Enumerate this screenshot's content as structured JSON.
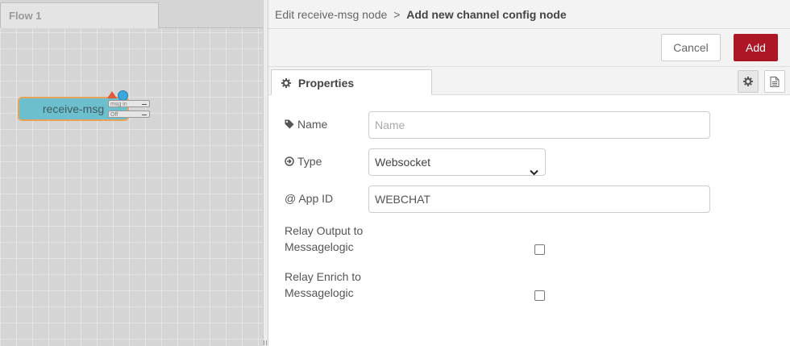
{
  "workspace": {
    "flow_tab": "Flow 1",
    "node": {
      "label": "receive-msg",
      "ports": [
        "msg in",
        "Off"
      ]
    }
  },
  "editor": {
    "breadcrumb_parent": "Edit receive-msg node",
    "breadcrumb_sep": ">",
    "breadcrumb_current": "Add new channel config node",
    "cancel_label": "Cancel",
    "add_label": "Add",
    "tab_properties": "Properties",
    "fields": {
      "name_label": "Name",
      "name_placeholder": "Name",
      "type_label": "Type",
      "type_value": "Websocket",
      "appid_label": "@ App ID",
      "appid_value": "WEBCHAT",
      "relay_output_label_1": "Relay Output to",
      "relay_output_label_2": "Messagelogic",
      "relay_enrich_label_1": "Relay Enrich to",
      "relay_enrich_label_2": "Messagelogic"
    }
  },
  "colors": {
    "add_button": "#ad1625",
    "node_fill": "#6cc0cd",
    "node_border": "#e8a35a"
  }
}
